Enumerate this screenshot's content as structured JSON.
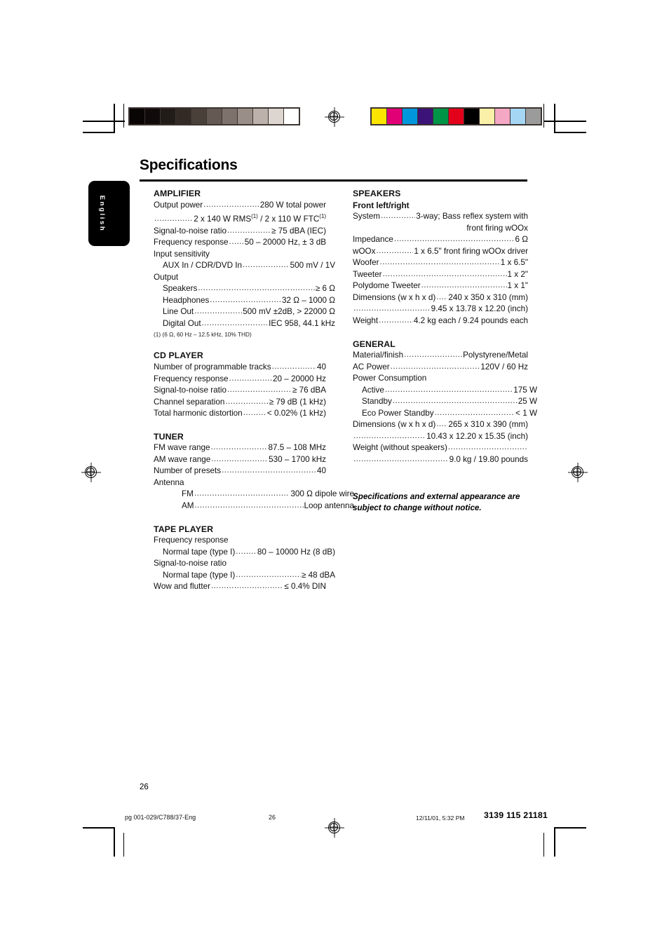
{
  "document": {
    "title": "Specifications",
    "language_tab": "English",
    "page_number": "26",
    "notice": "Specifications and external appearance are subject to change without notice."
  },
  "footer": {
    "file": "pg 001-029/C788/37-Eng",
    "page": "26",
    "timestamp": "12/11/01, 5:32 PM",
    "code": "3139 115 21181"
  },
  "calibration": {
    "grayscale": [
      "#0a0505",
      "#100a0a",
      "#221c18",
      "#332a26",
      "#4a403a",
      "#645a53",
      "#7e736c",
      "#9a8f88",
      "#bdb2ab",
      "#ddd6d0",
      "#ffffff"
    ],
    "color": [
      "#fbe400",
      "#e20077",
      "#0096dc",
      "#3c1376",
      "#009447",
      "#e2001a",
      "#000000",
      "#fbf0a8",
      "#f5a8c3",
      "#a5d7f5",
      "#9b9b9b"
    ]
  },
  "sections": {
    "amplifier": {
      "heading": "AMPLIFIER",
      "rows": [
        {
          "type": "leader",
          "label": "Output power",
          "value": "280 W total power"
        },
        {
          "type": "leader",
          "label": "",
          "value": "2 x 140 W RMS(1) / 2 x 110 W FTC(1)"
        },
        {
          "type": "leader",
          "label": "Signal-to-noise ratio",
          "value": "≥ 75 dBA (IEC)"
        },
        {
          "type": "leader",
          "label": "Frequency response",
          "value": "50 – 20000 Hz, ± 3 dB"
        },
        {
          "type": "plain",
          "label": "Input sensitivity"
        },
        {
          "type": "leader",
          "label": "AUX In / CDR/DVD In",
          "value": "500 mV / 1V",
          "indent": 1
        },
        {
          "type": "plain",
          "label": "Output"
        },
        {
          "type": "leader",
          "label": "Speakers",
          "value": "≥ 6 Ω",
          "indent": 1
        },
        {
          "type": "leader",
          "label": "Headphones",
          "value": "32 Ω – 1000 Ω",
          "indent": 1
        },
        {
          "type": "leader",
          "label": "Line Out",
          "value": "500 mV ±2dB, > 22000 Ω",
          "indent": 1
        },
        {
          "type": "leader",
          "label": "Digital Out",
          "value": "IEC 958, 44.1 kHz",
          "indent": 1
        }
      ],
      "footnote": "(1) (6 Ω, 60 Hz – 12.5 kHz, 10% THD)"
    },
    "cd_player": {
      "heading": "CD PLAYER",
      "rows": [
        {
          "type": "leader",
          "label": "Number of programmable tracks",
          "value": "40"
        },
        {
          "type": "leader",
          "label": "Frequency response",
          "value": "20 – 20000 Hz"
        },
        {
          "type": "leader",
          "label": "Signal-to-noise ratio",
          "value": "≥ 76 dBA"
        },
        {
          "type": "leader",
          "label": "Channel separation",
          "value": "≥ 79 dB (1 kHz)"
        },
        {
          "type": "leader",
          "label": "Total harmonic distortion",
          "value": "< 0.02% (1 kHz)"
        }
      ]
    },
    "tuner": {
      "heading": "TUNER",
      "rows": [
        {
          "type": "leader",
          "label": "FM wave range",
          "value": "87.5 – 108 MHz"
        },
        {
          "type": "leader",
          "label": "AM wave range",
          "value": "530 – 1700 kHz"
        },
        {
          "type": "leader",
          "label": "Number of presets",
          "value": "40"
        },
        {
          "type": "plain",
          "label": "Antenna"
        },
        {
          "type": "leader",
          "label": "FM",
          "value": "300 Ω dipole wire",
          "indent": 2
        },
        {
          "type": "leader",
          "label": "AM",
          "value": "Loop antenna",
          "indent": 2
        }
      ]
    },
    "tape_player": {
      "heading": "TAPE PLAYER",
      "rows": [
        {
          "type": "plain",
          "label": "Frequency response"
        },
        {
          "type": "leader",
          "label": "Normal tape (type I)",
          "value": "80 – 10000 Hz (8 dB)",
          "indent": 1
        },
        {
          "type": "plain",
          "label": "Signal-to-noise ratio"
        },
        {
          "type": "leader",
          "label": "Normal tape (type I)",
          "value": "≥ 48 dBA",
          "indent": 1
        },
        {
          "type": "leader",
          "label": "Wow and flutter",
          "value": "≤ 0.4% DIN"
        }
      ]
    },
    "speakers": {
      "heading": "SPEAKERS",
      "subheading": "Front left/right",
      "rows": [
        {
          "type": "leader",
          "label": "System",
          "value": "3-way; Bass reflex system with"
        },
        {
          "type": "right",
          "label": "front firing wOOx"
        },
        {
          "type": "leader",
          "label": "Impedance",
          "value": "6 Ω"
        },
        {
          "type": "leader",
          "label": "wOOx",
          "value": "1 x 6.5\" front firing wOOx driver"
        },
        {
          "type": "leader",
          "label": "Woofer",
          "value": "1 x 6.5\""
        },
        {
          "type": "leader",
          "label": "Tweeter",
          "value": "1 x 2\""
        },
        {
          "type": "leader",
          "label": "Polydome Tweeter",
          "value": "1 x 1\""
        },
        {
          "type": "leader",
          "label": "Dimensions (w x h x d)",
          "value": "240 x 350 x 310 (mm)"
        },
        {
          "type": "leader",
          "label": "",
          "value": "9.45 x 13.78 x 12.20 (inch)"
        },
        {
          "type": "leader",
          "label": "Weight",
          "value": "4.2 kg each / 9.24 pounds each"
        }
      ]
    },
    "general": {
      "heading": "GENERAL",
      "rows": [
        {
          "type": "leader",
          "label": "Material/finish",
          "value": "Polystyrene/Metal"
        },
        {
          "type": "leader",
          "label": "AC Power",
          "value": "120V / 60 Hz"
        },
        {
          "type": "plain",
          "label": "Power Consumption"
        },
        {
          "type": "leader",
          "label": "Active",
          "value": "175 W",
          "indent": 1
        },
        {
          "type": "leader",
          "label": "Standby",
          "value": "25 W",
          "indent": 1
        },
        {
          "type": "leader",
          "label": "Eco Power Standby",
          "value": "< 1 W",
          "indent": 1
        },
        {
          "type": "leader",
          "label": "Dimensions (w x h x d)",
          "value": "265 x 310 x 390 (mm)"
        },
        {
          "type": "leader",
          "label": "",
          "value": "10.43 x 12.20 x 15.35 (inch)"
        },
        {
          "type": "leader",
          "label": "Weight (without speakers)",
          "value": ""
        },
        {
          "type": "leader",
          "label": "",
          "value": "9.0 kg / 19.80 pounds"
        }
      ]
    }
  }
}
